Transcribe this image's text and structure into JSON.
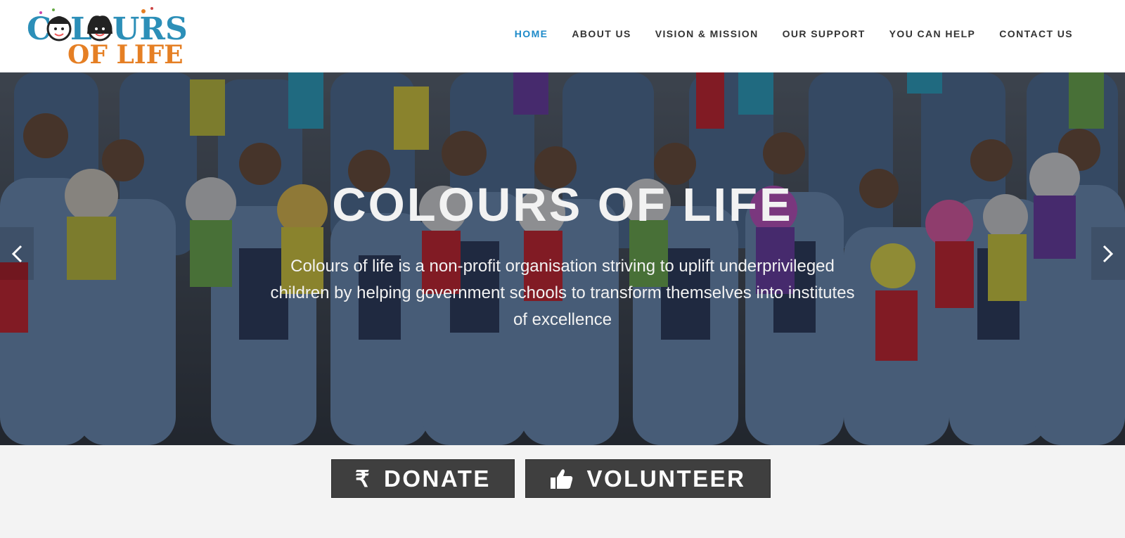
{
  "brand": {
    "logo_line1": "COLOURS",
    "logo_line2": "OF LIFE",
    "colors": {
      "blue": "#2c8fb8",
      "orange": "#e57f24"
    }
  },
  "nav": {
    "items": [
      {
        "label": "HOME",
        "active": true
      },
      {
        "label": "ABOUT US"
      },
      {
        "label": "VISION & MISSION"
      },
      {
        "label": "OUR SUPPORT"
      },
      {
        "label": "YOU CAN HELP"
      },
      {
        "label": "CONTACT US"
      }
    ],
    "active_color": "#1d8ac9"
  },
  "hero": {
    "title": "COLOURS OF LIFE",
    "description": "Colours of life is a non-profit organisation striving to uplift underprivileged children by helping government schools to transform themselves into institutes of excellence",
    "prev_icon": "chevron-left-icon",
    "next_icon": "chevron-right-icon"
  },
  "cta": {
    "donate_label": "DONATE",
    "donate_icon": "rupee-icon",
    "volunteer_label": "VOLUNTEER",
    "volunteer_icon": "thumbs-up-icon",
    "button_color": "#3f3f3f"
  }
}
